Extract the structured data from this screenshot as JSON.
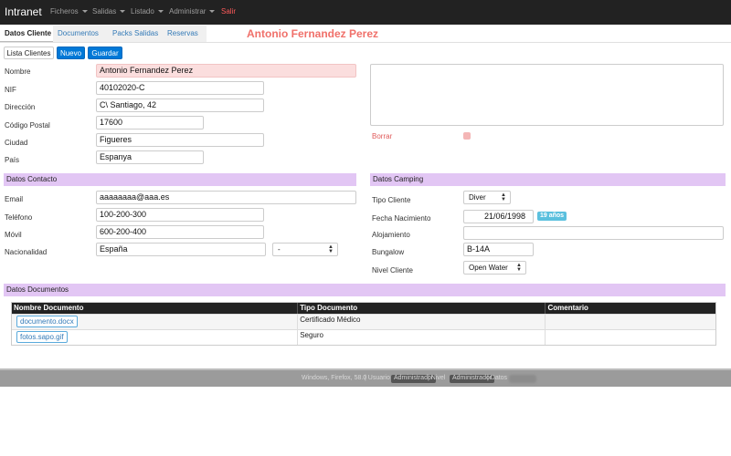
{
  "nav": {
    "brand": "Intranet",
    "items": [
      "Ficheros",
      "Salidas",
      "Listado",
      "Administrar"
    ],
    "logout": "Salir"
  },
  "tabs": [
    "Datos Cliente",
    "Documentos",
    "Packs Salidas",
    "Reservas"
  ],
  "client_name": "Antonio Fernandez Perez",
  "buttons": {
    "list": "Lista Clientes",
    "new": "Nuevo",
    "save": "Guardar"
  },
  "client": {
    "nombre": {
      "label": "Nombre",
      "value": "Antonio Fernandez Perez"
    },
    "nif": {
      "label": "NIF",
      "value": "40102020-C"
    },
    "direccion": {
      "label": "Dirección",
      "value": "C\\ Santiago, 42"
    },
    "cp": {
      "label": "Código Postal",
      "value": "17600"
    },
    "ciudad": {
      "label": "Ciudad",
      "value": "Figueres"
    },
    "pais": {
      "label": "País",
      "value": "Espanya"
    },
    "borrar_label": "Borrar"
  },
  "contacto": {
    "title": "Datos Contacto",
    "email": {
      "label": "Email",
      "value": "aaaaaaaa@aaa.es"
    },
    "telefono": {
      "label": "Teléfono",
      "value": "100-200-300"
    },
    "movil": {
      "label": "Móvil",
      "value": "600-200-400"
    },
    "nacionalidad": {
      "label": "Nacionalidad",
      "value": "España",
      "extra": "-"
    }
  },
  "camping": {
    "title": "Datos Camping",
    "tipo_cliente": {
      "label": "Tipo Cliente",
      "value": "Diver"
    },
    "fecha_nacimiento": {
      "label": "Fecha Nacimiento",
      "value": "21/06/1998",
      "age_badge": "19 años"
    },
    "alojamiento": {
      "label": "Alojamiento",
      "value": ""
    },
    "bungalow": {
      "label": "Bungalow",
      "value": "B-14A"
    },
    "nivel_cliente": {
      "label": "Nivel Cliente",
      "value": "Open Water"
    }
  },
  "documentos": {
    "title": "Datos Documentos",
    "columns": [
      "Nombre Documento",
      "Tipo Documento",
      "Comentario"
    ],
    "rows": [
      {
        "name": "documento.docx",
        "type": "Certificado Médico",
        "comment": ""
      },
      {
        "name": "fotos.sapo.gif",
        "type": "Seguro",
        "comment": ""
      }
    ]
  },
  "footer": {
    "env": "Windows, Firefox, 58.0",
    "user_label": "| Usuario",
    "user": "Administrador",
    "level_label": "| Nivel",
    "level": "Administrador",
    "db_label": "| Datos"
  },
  "colors": {
    "navbar": "#222222",
    "accent_header": "#f0706a",
    "primary": "#0078d7",
    "section": "#e2c6f4",
    "badge_info": "#5bc0de"
  }
}
